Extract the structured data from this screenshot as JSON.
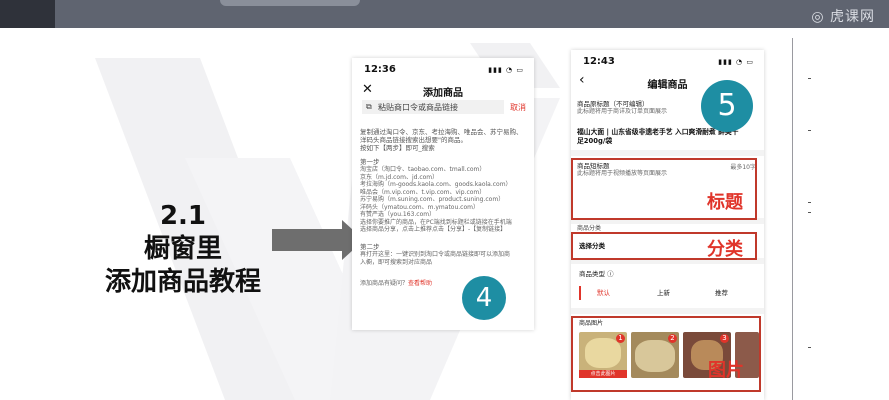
{
  "brand": {
    "logo": "虎课网"
  },
  "slide": {
    "title_line1": "2.1",
    "title_line2": "橱窗里",
    "title_line3": "添加商品教程"
  },
  "phone1": {
    "time": "12:36",
    "title": "添加商品",
    "search_placeholder": "粘贴商口令或商品链接",
    "cancel": "取消",
    "intro_line1": "复制通过淘口令、京东、考拉海购、唯品会、苏宁易购、",
    "intro_line2": "洋码头商品链接搜索出想要\"的商品。",
    "intro_line3": "按如下【两步】即可_搜索",
    "step1": "第一步",
    "step1_lines": [
      "淘宝店（淘口令、taobao.com、tmall.com）",
      "京东（m.jd.com、jd.com）",
      "考拉海购（m-goods.kaola.com、goods.kaola.com）",
      "唯品会（m.vip.com、t.vip.com、vip.com）",
      "苏宁易购（m.suning.com、product.suning.com）",
      "洋码头（ymatou.com、m.ymatou.com）",
      "有赞严选（you.163.com）",
      "选择你要推广的商品，在PC端找到标题栏或链接在手机端",
      "选择商品分享，点击上推荐点击【分享】-【复制链接】"
    ],
    "step2": "第二步",
    "step2_lines": [
      "再打开这里：一键识别到淘口令或商品链接即可以添加商",
      "入橱，即可搜索到对应商品"
    ],
    "help_prefix": "添加商品有疑问？",
    "help_link": "查看帮助",
    "badge": "4"
  },
  "phone2": {
    "time": "12:43",
    "title": "编辑商品",
    "source_title_label": "商品原标题（不可编辑）",
    "source_title_hint": "此标题将用于商详及订单页面展示",
    "product_title_line1": "福山大面 | 山东省级非遗老手艺 入口爽滑耐煮 鲜美十",
    "product_title_line2": "足200g/袋",
    "short_title_label": "商品短标题",
    "short_title_limit": "最多10字",
    "short_title_hint": "此标题将用于视频播放等页面展示",
    "category_label": "商品分类",
    "category_value": "选择分类",
    "type_label": "商品类型",
    "type_tabs": [
      "默认",
      "上新",
      "推荐"
    ],
    "images_label": "商品图片",
    "thumb_badges": [
      "1",
      "2",
      "3"
    ],
    "thumb_caption": "点击此图片",
    "badge": "5"
  },
  "labels": {
    "title_box": "标题",
    "category_box": "分类",
    "images_box": "图片"
  },
  "colors": {
    "accent_red": "#e0342a",
    "badge_teal": "#1e8ea3",
    "tab_active": "#e0342a"
  }
}
